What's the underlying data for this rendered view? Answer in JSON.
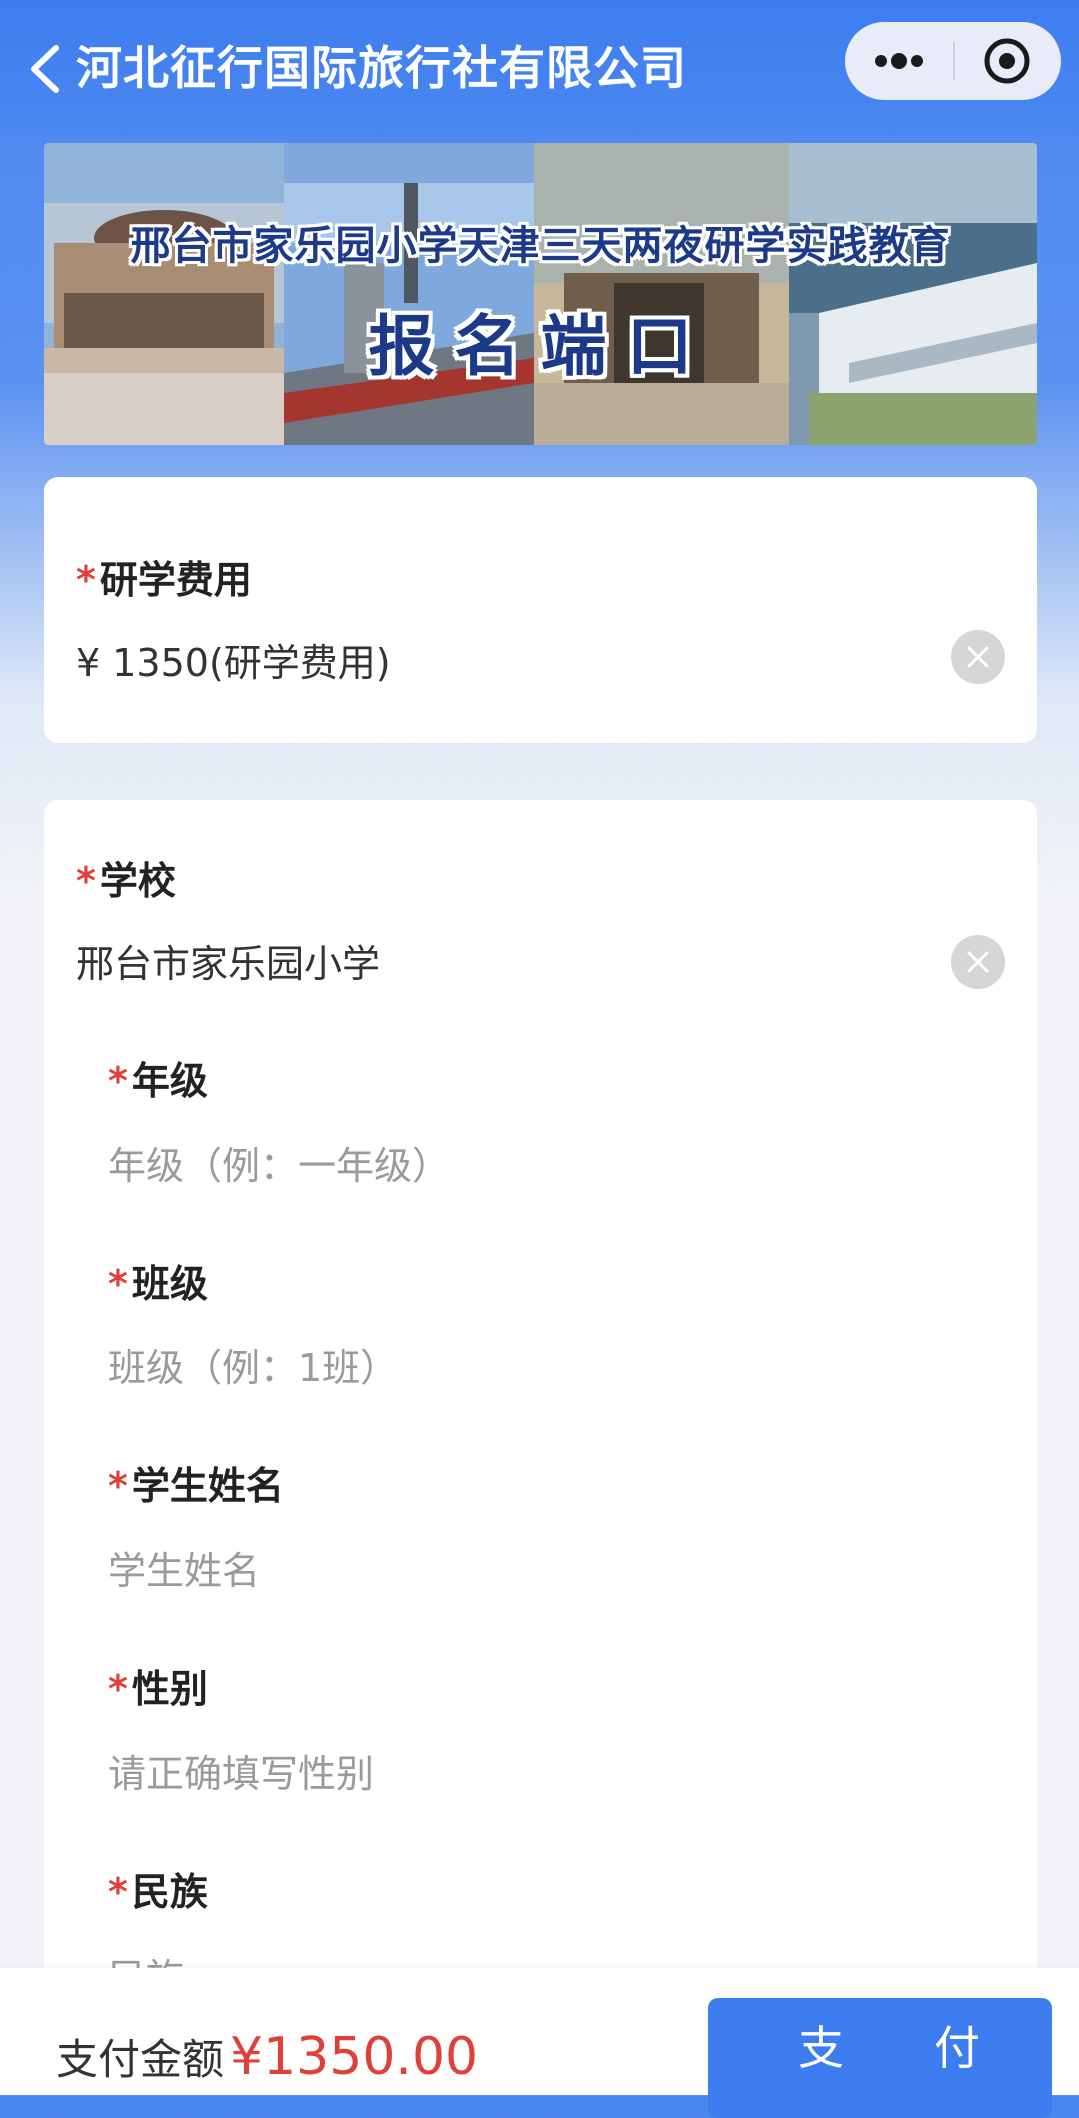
{
  "navbar": {
    "title": "河北征行国际旅行社有限公司",
    "back_icon": "chevron-left-icon",
    "more_icon": "more-dots-icon",
    "close_icon": "target-circle-icon"
  },
  "banner": {
    "line1": "邢台市家乐园小学天津三天两夜研学实践教育",
    "line2": "报名端口"
  },
  "fee_card": {
    "label": "研学费用",
    "value": "¥ 1350(研学费用)"
  },
  "school_card": {
    "school": {
      "label": "学校",
      "value": "邢台市家乐园小学"
    },
    "fields": [
      {
        "label": "年级",
        "placeholder": "年级（例：一年级）"
      },
      {
        "label": "班级",
        "placeholder": "班级（例：1班）"
      },
      {
        "label": "学生姓名",
        "placeholder": "学生姓名"
      },
      {
        "label": "性别",
        "placeholder": "请正确填写性别"
      },
      {
        "label": "民族",
        "placeholder": "民族"
      }
    ]
  },
  "required_mark": "*",
  "bottom_bar": {
    "pay_label": "支付金额",
    "pay_amount": "¥1350.00",
    "pay_button": "支付"
  },
  "colors": {
    "primary": "#3d7def",
    "required": "#e0403a",
    "placeholder": "#9a9a9a"
  }
}
